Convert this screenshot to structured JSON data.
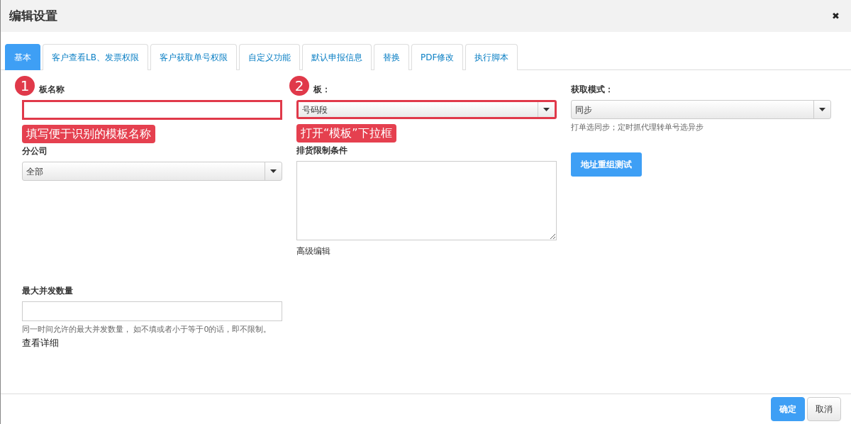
{
  "dialog": {
    "title": "编辑设置",
    "close": "✖"
  },
  "tabs": [
    {
      "label": "基本",
      "selected": true
    },
    {
      "label": "客户查看LB、发票权限",
      "selected": false
    },
    {
      "label": "客户获取单号权限",
      "selected": false
    },
    {
      "label": "自定义功能",
      "selected": false
    },
    {
      "label": "默认申报信息",
      "selected": false
    },
    {
      "label": "替换",
      "selected": false
    },
    {
      "label": "PDF修改",
      "selected": false
    },
    {
      "label": "执行脚本",
      "selected": false
    }
  ],
  "columns": [
    [
      {
        "kind": "input",
        "label": "板名称",
        "highlighted": true,
        "annotation": {
          "number": "1",
          "text": "填写便于识别的模板名称"
        }
      },
      {
        "kind": "select",
        "label": "分公司",
        "value": "全部",
        "highlighted": false
      }
    ],
    [
      {
        "kind": "select",
        "label": "板：",
        "value": "号码段",
        "highlighted": true,
        "annotation": {
          "number": "2",
          "text": "打开“模板”下拉框"
        }
      },
      {
        "kind": "textarea",
        "label": "排货限制条件",
        "link": "高级编辑",
        "highlighted": false
      }
    ],
    [
      {
        "kind": "select",
        "label": "获取模式：",
        "value": "同步",
        "help": "打单选同步；定时抓代理转单号选异步",
        "highlighted": false
      },
      {
        "kind": "button",
        "text": "地址重组测试"
      }
    ]
  ],
  "lower_fields": [
    {
      "kind": "input",
      "label": "最大并发数量",
      "help": "同一时间允许的最大并发数量， 如不填或者小于等于0的话，即不限制。",
      "help_link": "查看详细",
      "highlighted": false
    }
  ],
  "footer_buttons": [
    {
      "text": "确定",
      "primary": true
    },
    {
      "text": "取消",
      "primary": false
    }
  ]
}
